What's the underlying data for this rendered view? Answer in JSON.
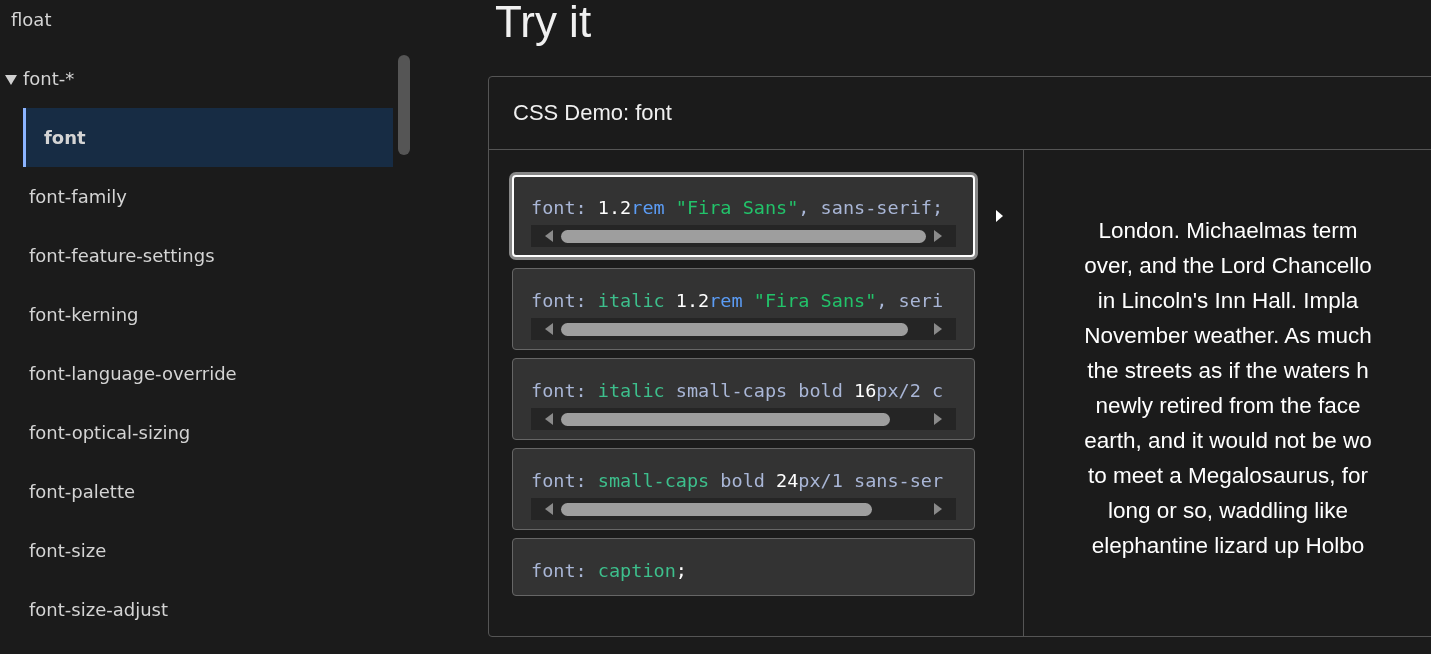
{
  "sidebar": {
    "items": [
      {
        "label": "float"
      },
      {
        "label": "font-*",
        "expanded": true,
        "children": [
          {
            "label": "font",
            "selected": true
          },
          {
            "label": "font-family",
            "selected": false
          },
          {
            "label": "font-feature-settings",
            "selected": false
          },
          {
            "label": "font-kerning",
            "selected": false
          },
          {
            "label": "font-language-override",
            "selected": false
          },
          {
            "label": "font-optical-sizing",
            "selected": false
          },
          {
            "label": "font-palette",
            "selected": false
          },
          {
            "label": "font-size",
            "selected": false
          },
          {
            "label": "font-size-adjust",
            "selected": false
          }
        ]
      }
    ]
  },
  "heading": "Try it",
  "demo": {
    "title": "CSS Demo: font",
    "options": [
      {
        "selected": true,
        "scrollable": true,
        "tokens": [
          {
            "kind": "prop",
            "text": "font: "
          },
          {
            "kind": "num",
            "text": "1.2"
          },
          {
            "kind": "unit",
            "text": "rem"
          },
          {
            "kind": "str",
            "text": " \"Fira Sans\""
          },
          {
            "kind": "prop",
            "text": ", sans-serif;"
          }
        ]
      },
      {
        "selected": false,
        "scrollable": true,
        "tokens": [
          {
            "kind": "prop",
            "text": "font: "
          },
          {
            "kind": "kw",
            "text": "italic"
          },
          {
            "kind": "num",
            "text": " 1.2"
          },
          {
            "kind": "unit",
            "text": "rem"
          },
          {
            "kind": "str",
            "text": " \"Fira Sans\""
          },
          {
            "kind": "prop",
            "text": ", seri"
          }
        ]
      },
      {
        "selected": false,
        "scrollable": true,
        "tokens": [
          {
            "kind": "prop",
            "text": "font: "
          },
          {
            "kind": "kw",
            "text": "italic"
          },
          {
            "kind": "prop",
            "text": " small-caps bold "
          },
          {
            "kind": "num",
            "text": "16"
          },
          {
            "kind": "prop",
            "text": "px/2 c"
          }
        ]
      },
      {
        "selected": false,
        "scrollable": true,
        "tokens": [
          {
            "kind": "prop",
            "text": "font: "
          },
          {
            "kind": "kw",
            "text": "small-caps"
          },
          {
            "kind": "prop",
            "text": " bold "
          },
          {
            "kind": "num",
            "text": "24"
          },
          {
            "kind": "prop",
            "text": "px/1 sans-ser"
          }
        ]
      },
      {
        "selected": false,
        "scrollable": false,
        "tokens": [
          {
            "kind": "prop",
            "text": "font: "
          },
          {
            "kind": "kw",
            "text": "caption"
          },
          {
            "kind": "num",
            "text": ";"
          }
        ]
      }
    ],
    "preview_lines": [
      "London. Michaelmas term",
      "over, and the Lord Chancello",
      "in Lincoln's Inn Hall. Impla",
      "November weather. As much",
      "the streets as if the waters h",
      "newly retired from the face",
      "earth, and it would not be wo",
      "to meet a Megalosaurus, for",
      "long or so, waddling like",
      "elephantine lizard up Holbo"
    ]
  }
}
